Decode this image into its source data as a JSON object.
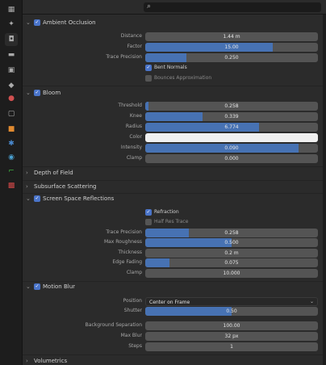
{
  "header": {
    "search_icon": "search-icon",
    "editor_icon": "properties-editor-icon"
  },
  "tabs": [
    "tool",
    "render",
    "output",
    "view-layer",
    "scene",
    "world",
    "object",
    "modifiers",
    "particles",
    "physics",
    "constraints",
    "data",
    "material"
  ],
  "ambient_occlusion": {
    "title": "Ambient Occlusion",
    "distance_label": "Distance",
    "distance_value": "1.44 m",
    "factor_label": "Factor",
    "factor_value": "15.00",
    "trace_precision_label": "Trace Precision",
    "trace_precision_value": "0.250",
    "bent_normals_label": "Bent Normals",
    "bounces_label": "Bounces Approximation"
  },
  "bloom": {
    "title": "Bloom",
    "threshold_label": "Threshold",
    "threshold_value": "0.258",
    "knee_label": "Knee",
    "knee_value": "0.339",
    "radius_label": "Radius",
    "radius_value": "6.774",
    "color_label": "Color",
    "color_hex": "#ffffff",
    "intensity_label": "Intensity",
    "intensity_value": "0.090",
    "clamp_label": "Clamp",
    "clamp_value": "0.000"
  },
  "depth_of_field": {
    "title": "Depth of Field"
  },
  "subsurface": {
    "title": "Subsurface Scattering"
  },
  "ssr": {
    "title": "Screen Space Reflections",
    "refraction_label": "Refraction",
    "half_res_label": "Half Res Trace",
    "trace_precision_label": "Trace Precision",
    "trace_precision_value": "0.258",
    "max_roughness_label": "Max Roughness",
    "max_roughness_value": "0.500",
    "thickness_label": "Thickness",
    "thickness_value": "0.2 m",
    "edge_fading_label": "Edge Fading",
    "edge_fading_value": "0.075",
    "clamp_label": "Clamp",
    "clamp_value": "10.000"
  },
  "motion_blur": {
    "title": "Motion Blur",
    "position_label": "Position",
    "position_value": "Center on Frame",
    "shutter_label": "Shutter",
    "shutter_value": "0.50",
    "bg_sep_label": "Background Separation",
    "bg_sep_value": "100.00",
    "max_blur_label": "Max Blur",
    "max_blur_value": "32 px",
    "steps_label": "Steps",
    "steps_value": "1"
  },
  "volumetrics": {
    "title": "Volumetrics"
  },
  "slider_fills": {
    "factor": 0.74,
    "trace_precision": 0.24,
    "threshold": 0.02,
    "knee": 0.33,
    "radius": 0.66,
    "intensity": 0.89,
    "ssr_trace": 0.25,
    "max_roughness": 0.5,
    "edge_fading": 0.14,
    "shutter": 0.5
  },
  "colors": {
    "accent": "#4772b3",
    "field": "#545454",
    "panel": "#2b2b2b"
  }
}
